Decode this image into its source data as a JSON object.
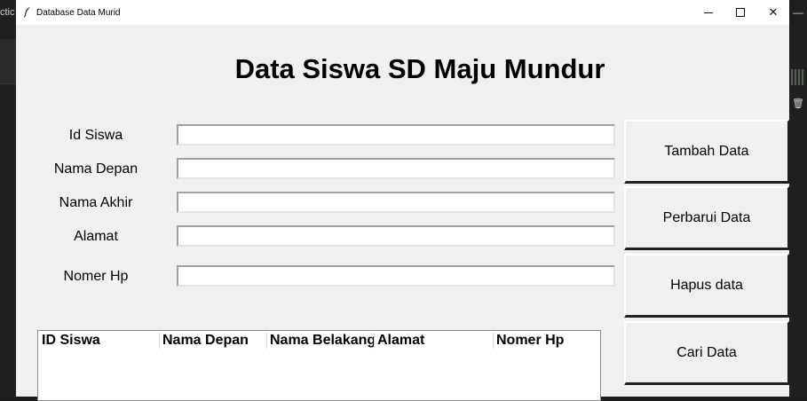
{
  "background": {
    "left_text": "ctic",
    "right_dash": "—",
    "right_icon": "🗑"
  },
  "window": {
    "title": "Database Data Murid",
    "controls": {
      "minimize": "—",
      "maximize": "☐",
      "close": "✕"
    }
  },
  "heading": "Data Siswa SD Maju Mundur",
  "form": {
    "fields": [
      {
        "label": "Id Siswa",
        "value": ""
      },
      {
        "label": "Nama Depan",
        "value": ""
      },
      {
        "label": "Nama Akhir",
        "value": ""
      },
      {
        "label": "Alamat",
        "value": ""
      },
      {
        "label": "Nomer Hp",
        "value": ""
      }
    ]
  },
  "buttons": {
    "add": "Tambah Data",
    "update": "Perbarui Data",
    "delete": "Hapus data",
    "search": "Cari Data"
  },
  "table": {
    "columns": [
      "ID Siswa",
      "Nama Depan",
      "Nama Belakang",
      "Alamat",
      "Nomer Hp"
    ],
    "rows": []
  }
}
